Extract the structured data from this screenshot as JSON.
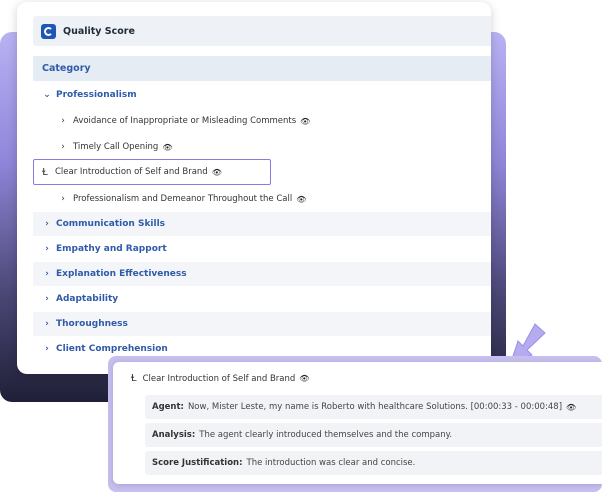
{
  "header": {
    "title": "Quality Score",
    "logo_icon": "headset-logo-icon"
  },
  "category": {
    "label": "Category"
  },
  "tree": {
    "professionalism": {
      "label": "Professionalism",
      "children": [
        {
          "label": "Avoidance of Inappropriate or Misleading Comments"
        },
        {
          "label": "Timely Call Opening"
        },
        {
          "label": "Clear Introduction of Self and Brand"
        },
        {
          "label": "Professionalism and Demeanor Throughout the Call"
        }
      ]
    },
    "categories": [
      {
        "label": "Communication Skills"
      },
      {
        "label": "Empathy and Rapport"
      },
      {
        "label": "Explanation Effectiveness"
      },
      {
        "label": "Adaptability"
      },
      {
        "label": "Thoroughness"
      },
      {
        "label": "Client Comprehension"
      }
    ]
  },
  "detail": {
    "title": "Clear Introduction of Self and Brand",
    "agent": {
      "label": "Agent:",
      "text": "Now, Mister Leste, my name is Roberto with healthcare Solutions. [00:00:33 - 00:00:48]"
    },
    "analysis": {
      "label": "Analysis:",
      "text": "The agent clearly introduced themselves and the company."
    },
    "justification": {
      "label": "Score Justification:",
      "text": "The introduction was clear and concise."
    }
  },
  "icons": {
    "chevron_down": "⌄",
    "chevron_right": "›",
    "eye": "👁",
    "cursor": "Ɫ"
  },
  "colors": {
    "accent": "#2f5ba8",
    "highlight_border": "#8f78e6",
    "gradient_top": "#b9b2f3",
    "gradient_bottom": "#1f2037"
  }
}
